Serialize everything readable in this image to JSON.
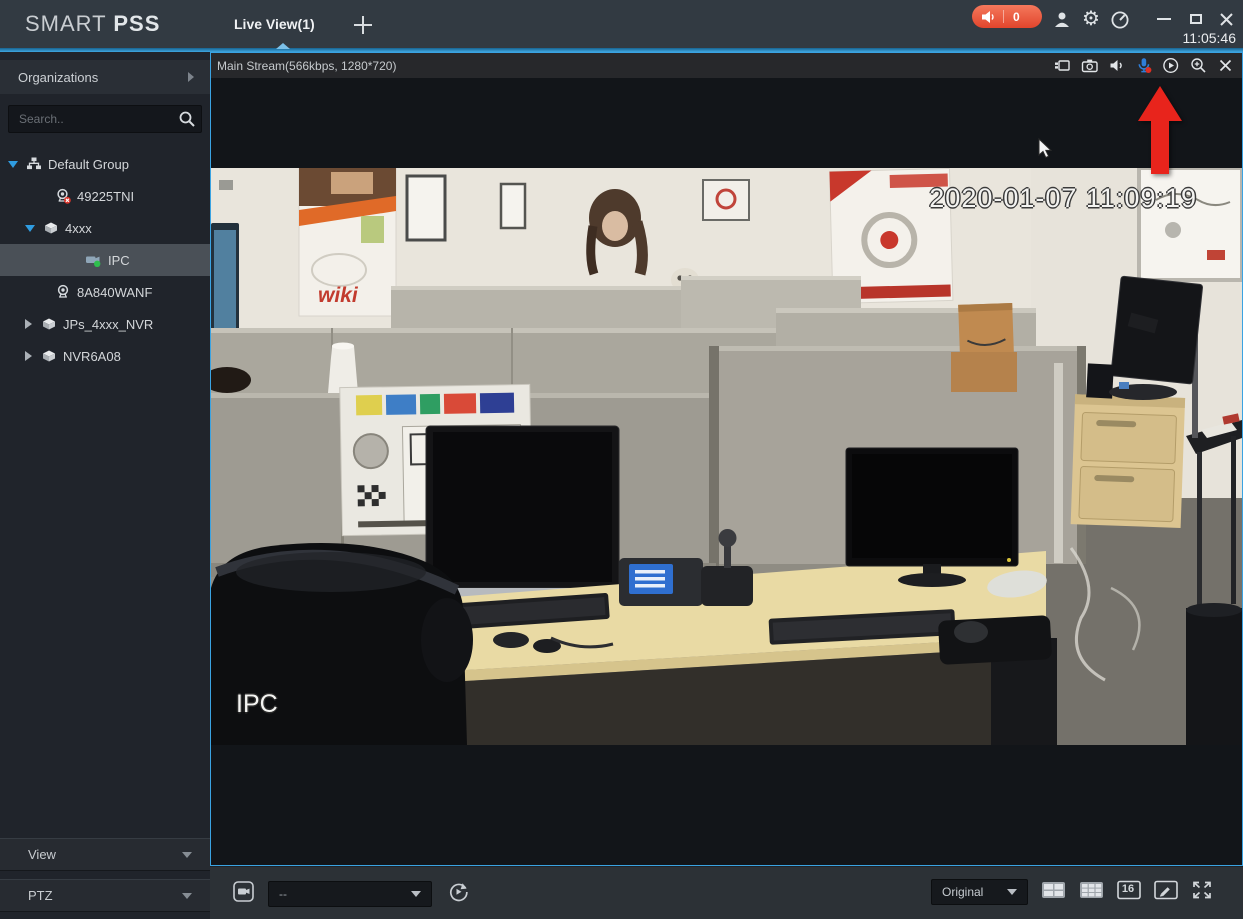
{
  "app": {
    "brand_smart": "SMART",
    "brand_pss": "PSS",
    "time": "11:05:46",
    "alarm_count": "0"
  },
  "icons": {
    "gear": "⚙"
  },
  "tabs": {
    "live_view_label": "Live View(1)"
  },
  "sidebar": {
    "organizations_label": "Organizations",
    "search_placeholder": "Search..",
    "tree": [
      {
        "label": "Default Group",
        "level": 0,
        "state": "expanded",
        "status": ""
      },
      {
        "label": "49225TNI",
        "level": 1,
        "state": "leaf",
        "status": "offline"
      },
      {
        "label": "4xxx",
        "level": 1,
        "state": "expanded",
        "status": ""
      },
      {
        "label": "IPC",
        "level": 2,
        "state": "leaf",
        "status": "online",
        "selected": true
      },
      {
        "label": "8A840WANF",
        "level": 1,
        "state": "leaf",
        "status": ""
      },
      {
        "label": "JPs_4xxx_NVR",
        "level": 1,
        "state": "collapsed",
        "status": ""
      },
      {
        "label": "NVR6A08",
        "level": 1,
        "state": "collapsed",
        "status": ""
      }
    ],
    "view_label": "View",
    "ptz_label": "PTZ"
  },
  "video": {
    "stream_title": "Main Stream(566kbps, 1280*720)",
    "osd_timestamp": "2020-01-07 11:09:19",
    "camera_label": "IPC",
    "poster_text": "wiki",
    "toolbar_icon_names": [
      "record",
      "snapshot",
      "audio",
      "talk",
      "instant-playback",
      "digital-zoom",
      "close"
    ]
  },
  "toolbar": {
    "view_preset_value": "--",
    "scale_value": "Original",
    "split_16_label": "16"
  },
  "colors": {
    "accent_blue": "#3fa7e0",
    "alarm_red": "#e2452c",
    "online_green": "#2fbf4e",
    "offline_red": "#d9352b",
    "arrow_red": "#e8241c",
    "mic_blue": "#2e7ed8"
  }
}
